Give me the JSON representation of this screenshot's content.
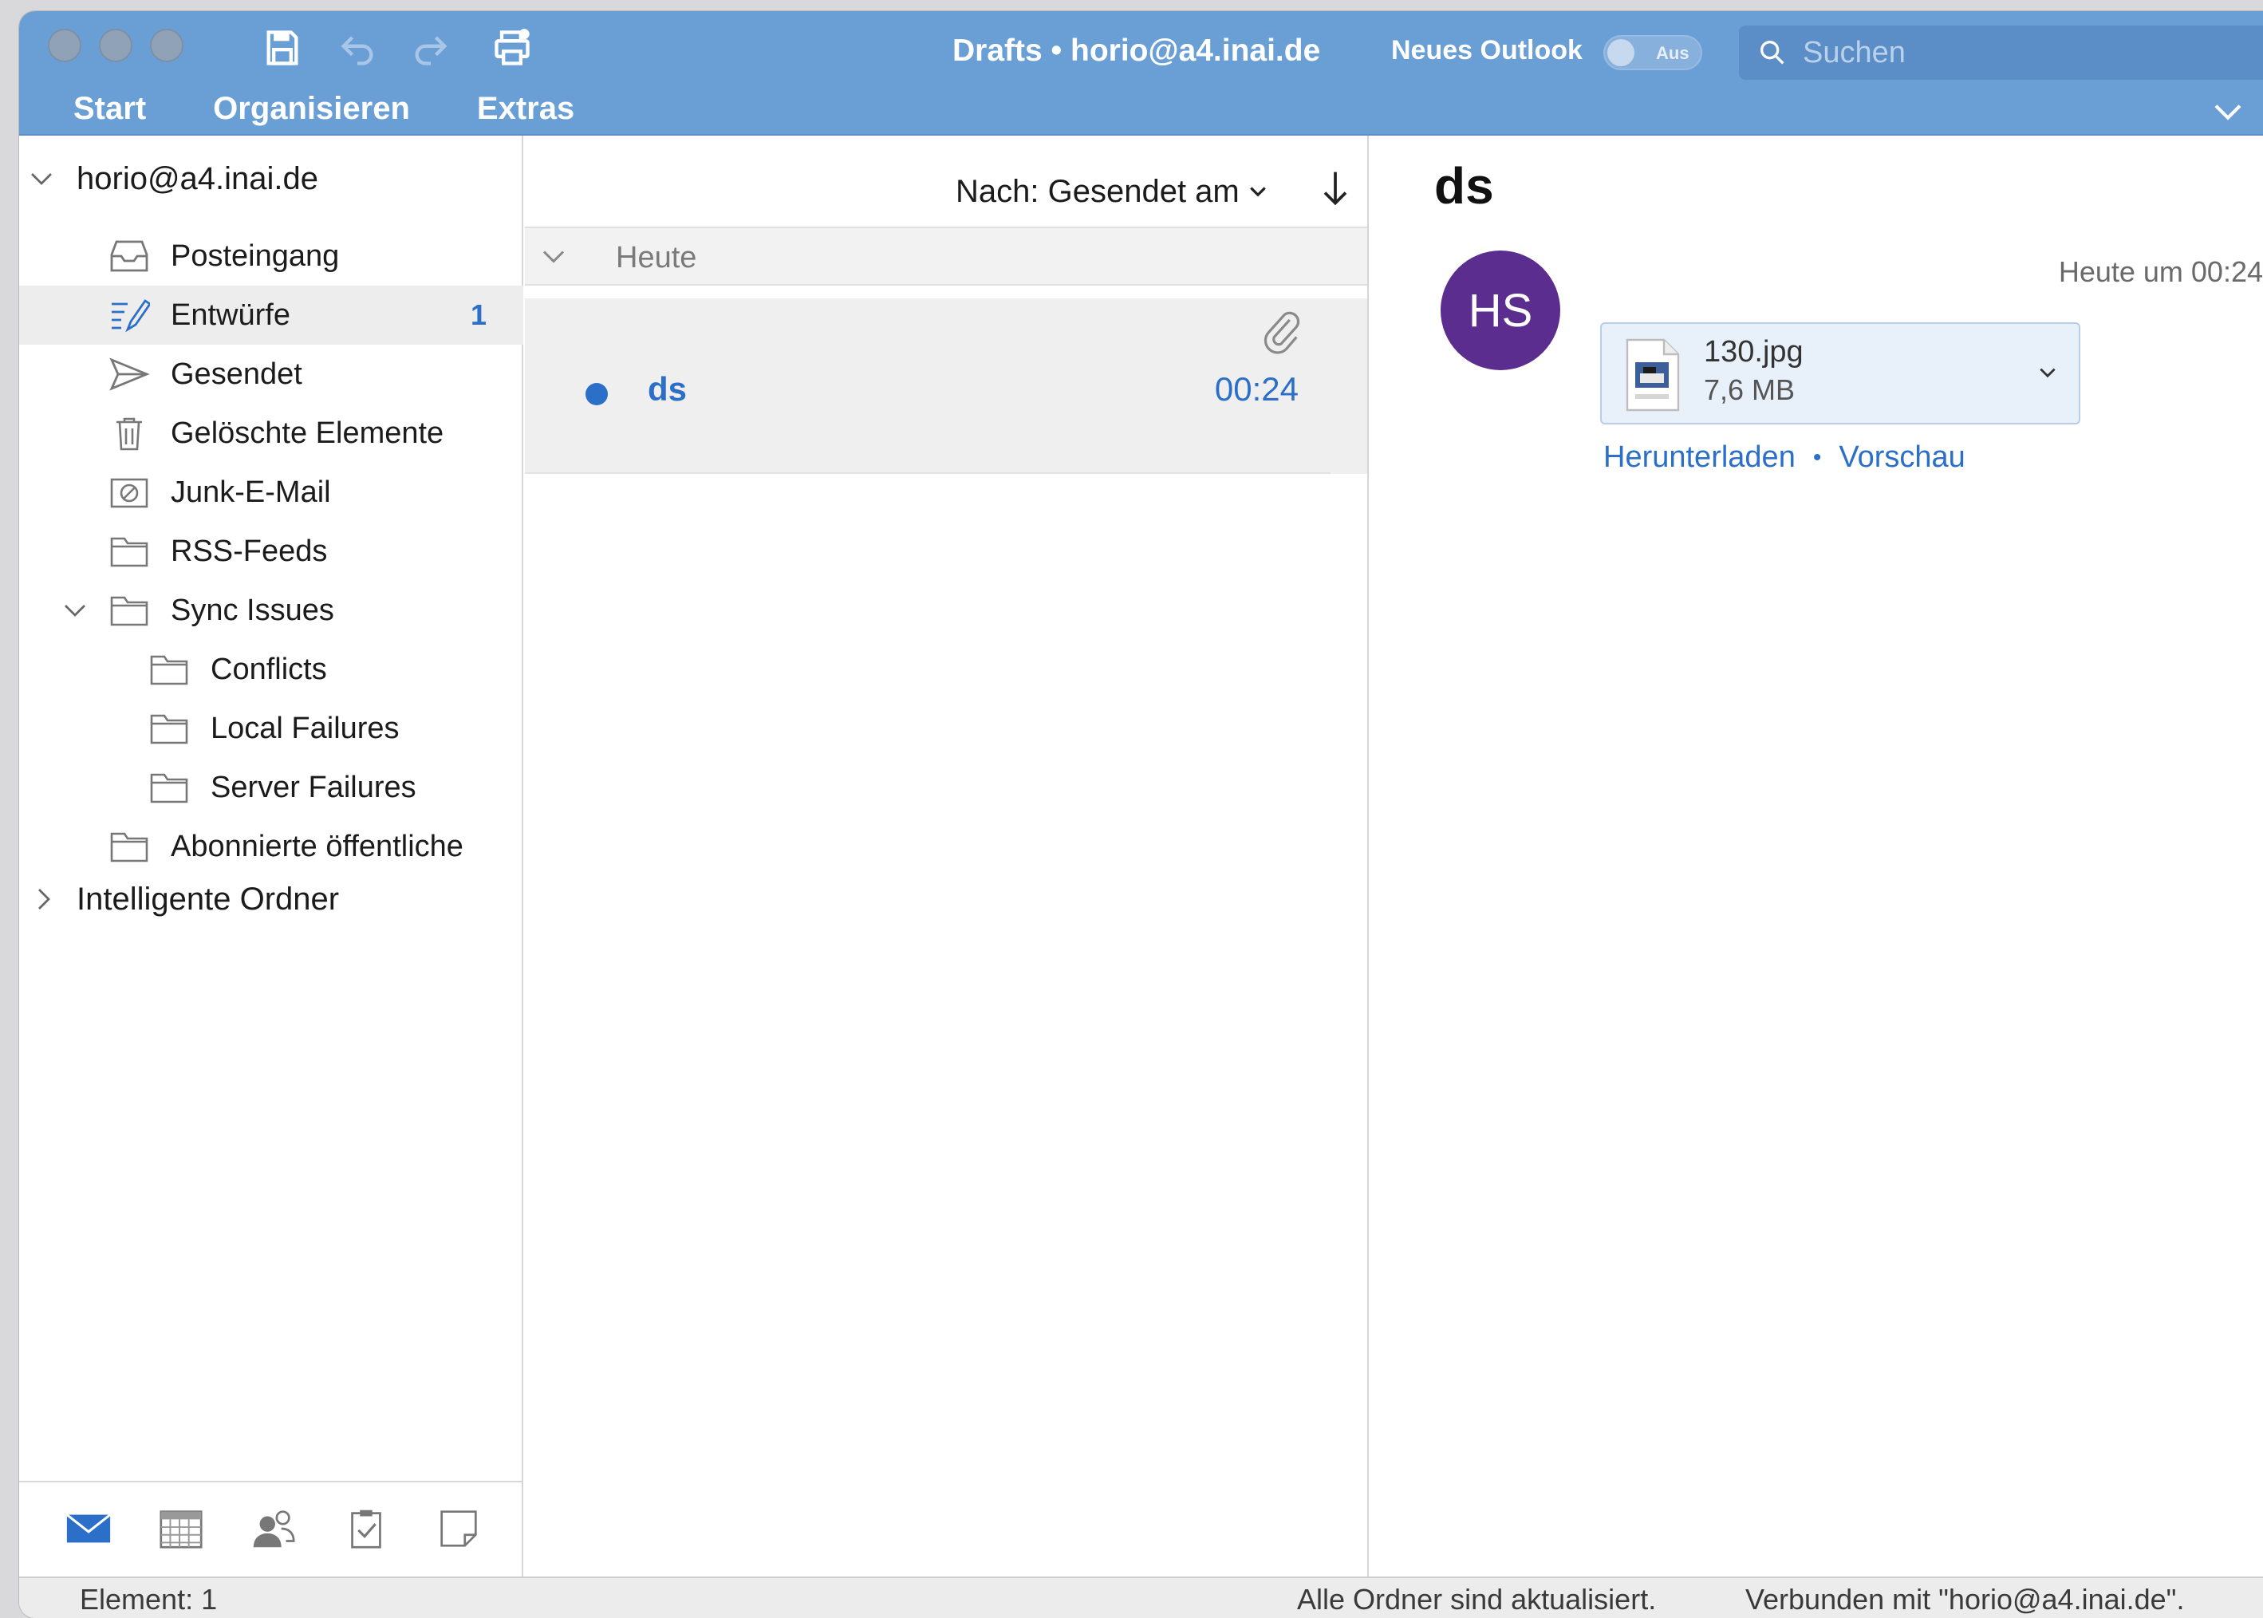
{
  "window": {
    "title": "Drafts • horio@a4.inai.de",
    "new_outlook_label": "Neues Outlook",
    "toggle_label": "Aus",
    "search_placeholder": "Suchen"
  },
  "menu": {
    "tabs": [
      "Start",
      "Organisieren",
      "Extras"
    ]
  },
  "toolbar_icons": [
    "save-icon",
    "undo-icon",
    "redo-icon",
    "print-icon"
  ],
  "sidebar": {
    "account": "horio@a4.inai.de",
    "folders": [
      {
        "label": "Posteingang",
        "icon": "inbox-icon"
      },
      {
        "label": "Entwürfe",
        "icon": "drafts-icon",
        "count": "1",
        "selected": true
      },
      {
        "label": "Gesendet",
        "icon": "sent-icon"
      },
      {
        "label": "Gelöschte Elemente",
        "icon": "trash-icon"
      },
      {
        "label": "Junk-E-Mail",
        "icon": "junk-icon"
      },
      {
        "label": "RSS-Feeds",
        "icon": "folder-icon"
      },
      {
        "label": "Sync Issues",
        "icon": "folder-icon",
        "expanded": true
      },
      {
        "label": "Conflicts",
        "icon": "folder-icon"
      },
      {
        "label": "Local Failures",
        "icon": "folder-icon"
      },
      {
        "label": "Server Failures",
        "icon": "folder-icon"
      },
      {
        "label": "Abonnierte öffentliche",
        "icon": "folder-icon"
      }
    ],
    "smart_folders": "Intelligente Ordner",
    "nav_icons": [
      "mail-icon",
      "calendar-icon",
      "people-icon",
      "tasks-icon",
      "notes-icon"
    ]
  },
  "message_list": {
    "sort_label": "Nach: Gesendet am",
    "group": "Heute",
    "messages": [
      {
        "subject": "ds",
        "time": "00:24",
        "unread": true,
        "has_attachment": true
      }
    ]
  },
  "reading": {
    "subject": "ds",
    "avatar_initials": "HS",
    "timestamp": "Heute um 00:24",
    "attachment": {
      "name": "130.jpg",
      "size": "7,6 MB"
    },
    "download_label": "Herunterladen",
    "separator": "•",
    "preview_label": "Vorschau"
  },
  "status": {
    "items": "Element: 1",
    "sync": "Alle Ordner sind aktualisiert.",
    "connection": "Verbunden mit \"horio@a4.inai.de\"."
  },
  "colors": {
    "titlebar": "#6a9fd6",
    "accent": "#2b6fc9",
    "avatar": "#5b2d8e",
    "selection": "#ededed"
  }
}
